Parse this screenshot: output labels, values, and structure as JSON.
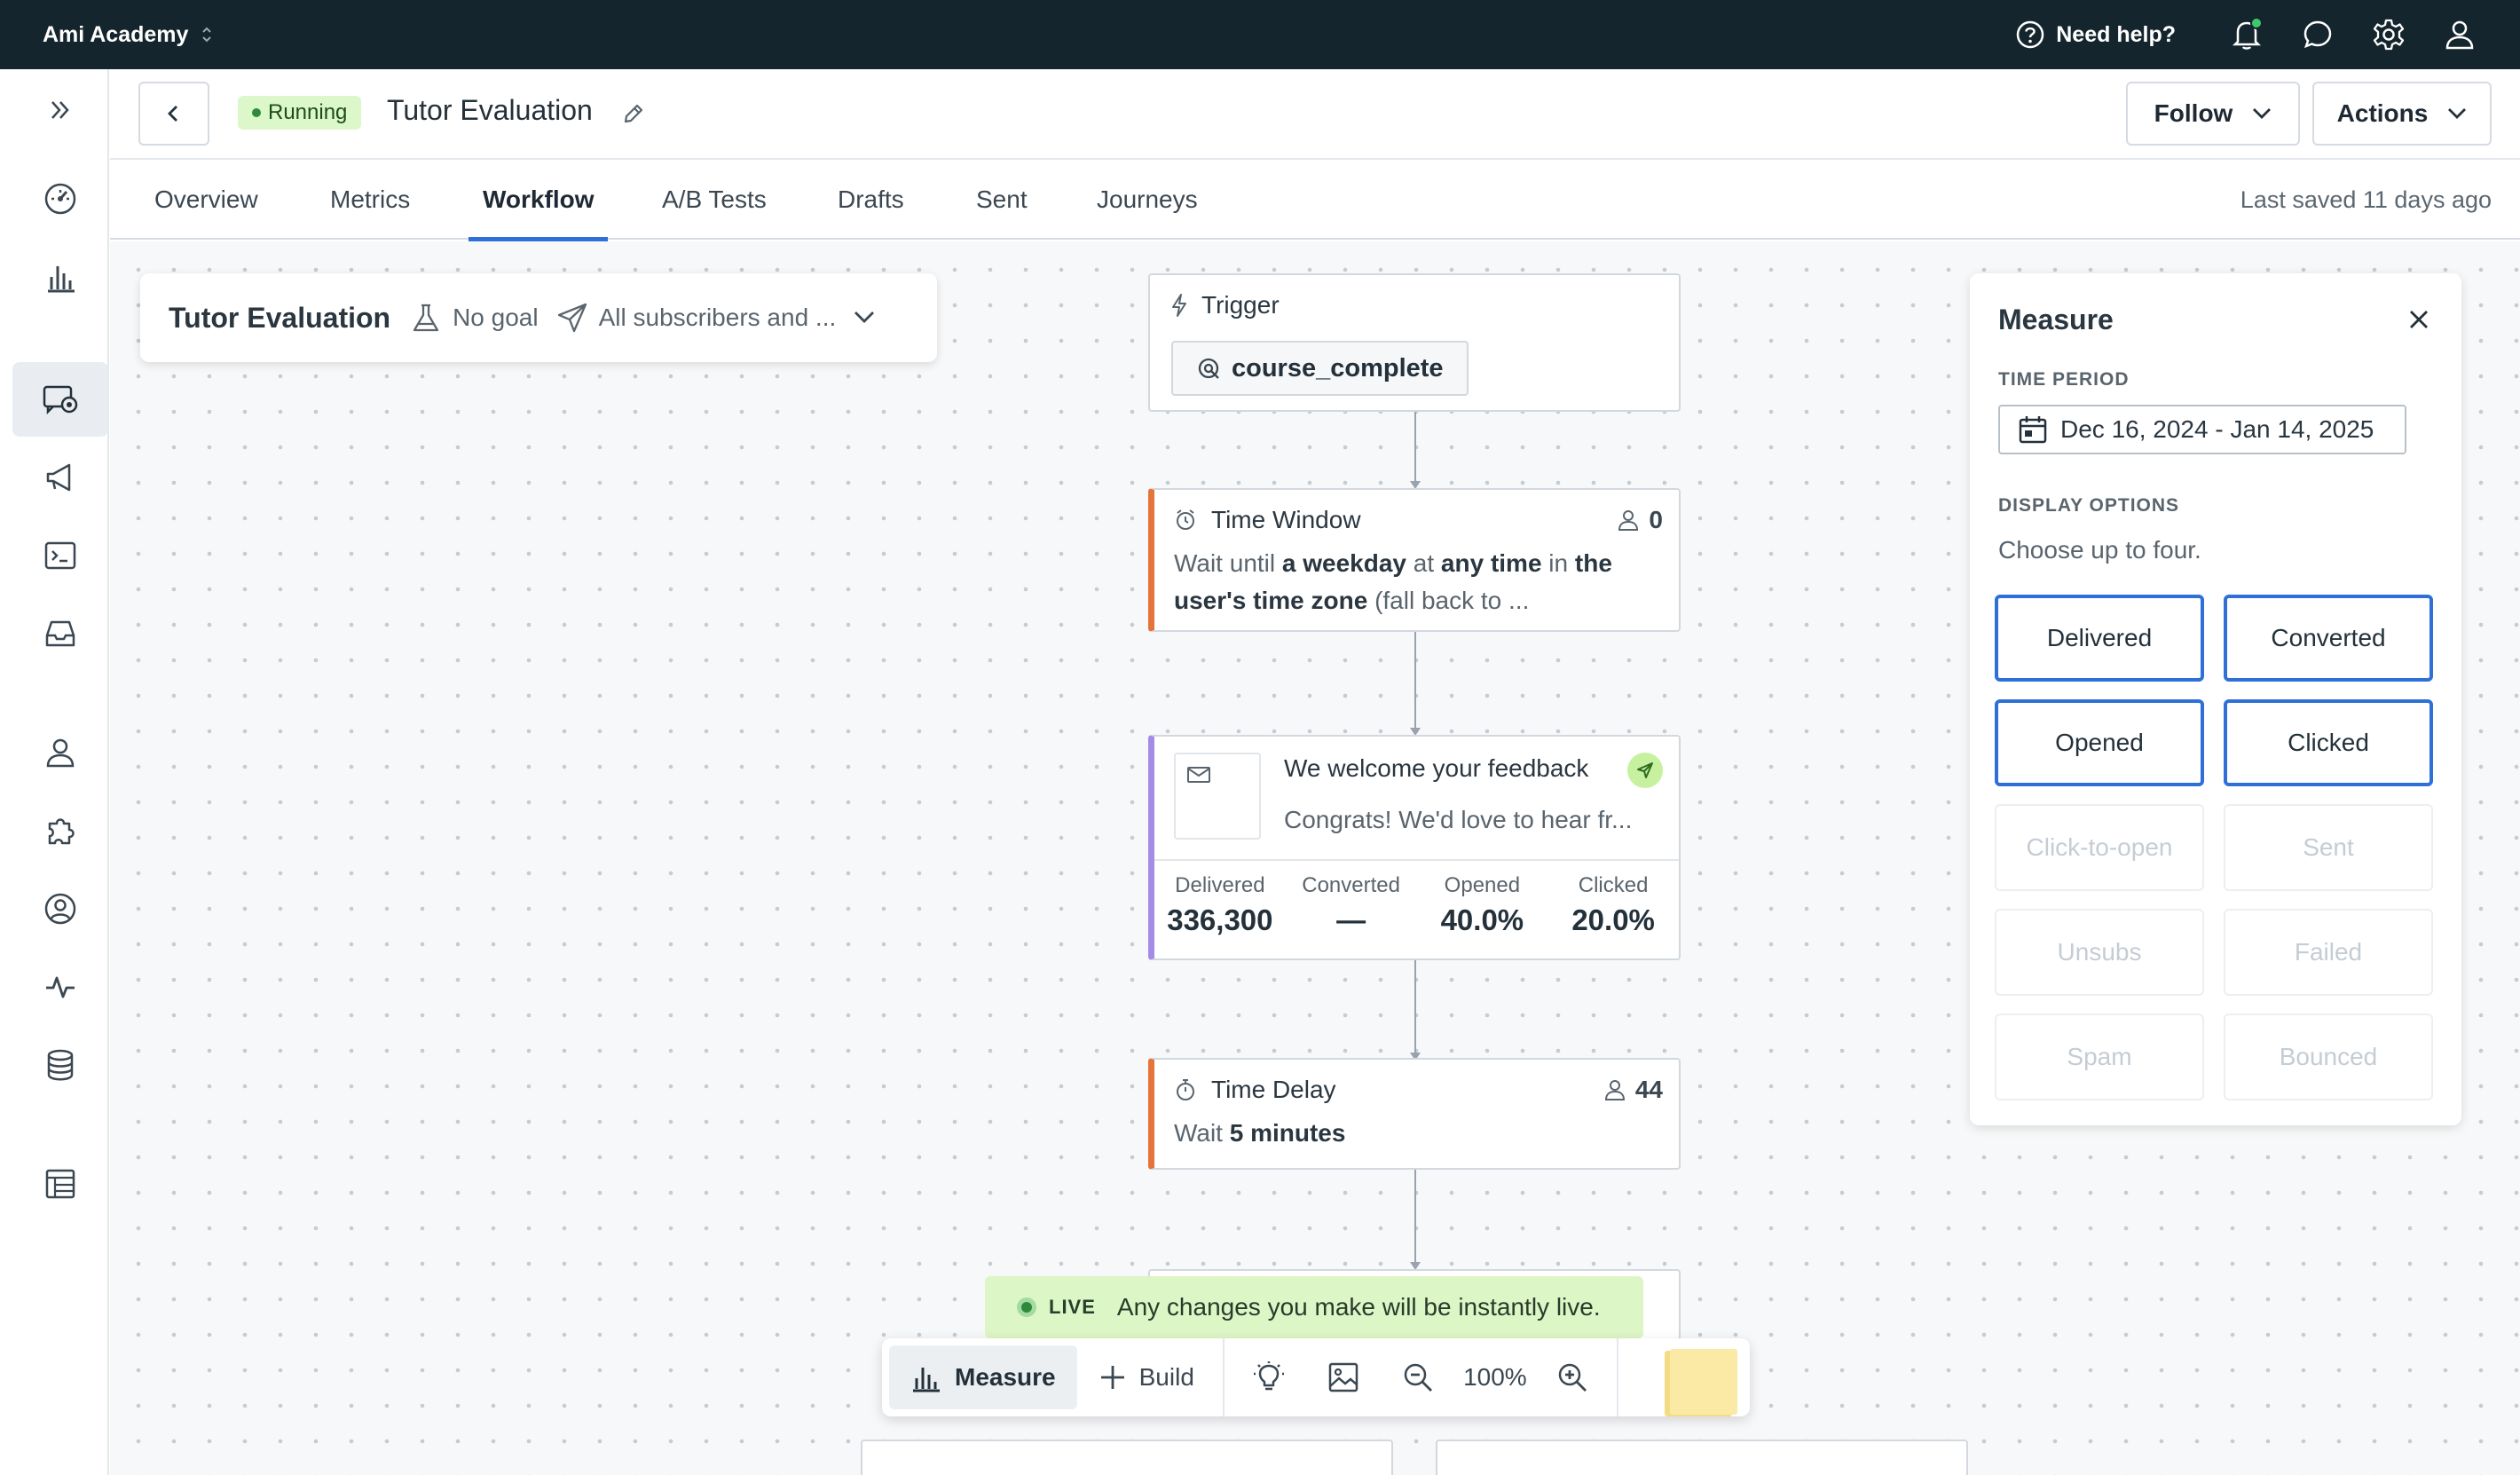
{
  "topbar": {
    "workspace": "Ami Academy",
    "help_label": "Need help?"
  },
  "header": {
    "status": "Running",
    "title": "Tutor Evaluation",
    "follow_label": "Follow",
    "actions_label": "Actions"
  },
  "tabs": [
    {
      "label": "Overview"
    },
    {
      "label": "Metrics"
    },
    {
      "label": "Workflow",
      "active": true
    },
    {
      "label": "A/B Tests"
    },
    {
      "label": "Drafts"
    },
    {
      "label": "Sent"
    },
    {
      "label": "Journeys"
    }
  ],
  "last_saved": "Last saved 11 days ago",
  "summary": {
    "title": "Tutor Evaluation",
    "goal": "No goal",
    "audience": "All subscribers and ..."
  },
  "trigger": {
    "label": "Trigger",
    "event": "course_complete"
  },
  "time_window": {
    "label": "Time Window",
    "count": "0",
    "desc_1": "Wait until ",
    "desc_2": "a weekday",
    "desc_3": " at ",
    "desc_4": "any time",
    "desc_5": " in ",
    "desc_6": "the",
    "desc_7": "user's time zone",
    "desc_8": " (fall back to ..."
  },
  "email": {
    "subject": "We welcome your feedback",
    "preview": "Congrats! We'd love to hear fr...",
    "stats": [
      {
        "label": "Delivered",
        "value": "336,300"
      },
      {
        "label": "Converted",
        "value": "—"
      },
      {
        "label": "Opened",
        "value": "40.0%"
      },
      {
        "label": "Clicked",
        "value": "20.0%"
      }
    ]
  },
  "time_delay": {
    "label": "Time Delay",
    "count": "44",
    "desc_1": "Wait ",
    "desc_2": "5 minutes"
  },
  "live": {
    "tag": "LIVE",
    "message": "Any changes you make will be instantly live."
  },
  "toolbar": {
    "measure_label": "Measure",
    "build_label": "Build",
    "zoom": "100%"
  },
  "measure": {
    "title": "Measure",
    "time_period_label": "TIME PERIOD",
    "date_range": "Dec 16, 2024 - Jan 14, 2025",
    "display_options_label": "DISPLAY OPTIONS",
    "help": "Choose up to four.",
    "options": [
      {
        "label": "Delivered",
        "selected": true
      },
      {
        "label": "Converted",
        "selected": true
      },
      {
        "label": "Opened",
        "selected": true
      },
      {
        "label": "Clicked",
        "selected": true
      },
      {
        "label": "Click-to-open",
        "selected": false
      },
      {
        "label": "Sent",
        "selected": false
      },
      {
        "label": "Unsubs",
        "selected": false
      },
      {
        "label": "Failed",
        "selected": false
      },
      {
        "label": "Spam",
        "selected": false
      },
      {
        "label": "Bounced",
        "selected": false
      }
    ]
  },
  "colors": {
    "topbar_bg": "#14252d",
    "accent_blue": "#2e6fd8",
    "accent_orange": "#e5733a",
    "accent_purple": "#a48ce6",
    "live_green": "#ddf6c6"
  }
}
